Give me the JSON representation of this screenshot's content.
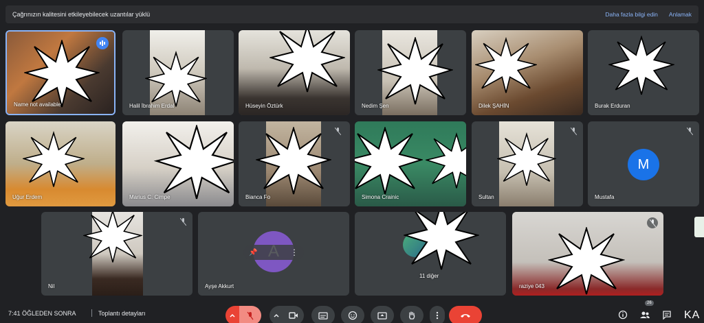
{
  "notice": {
    "message": "Çağrınızın kalitesini etkileyebilecek uzantılar yüklü",
    "learn_more": "Daha fazla bilgi edin",
    "dismiss": "Anlamak"
  },
  "participants": [
    {
      "name": "Name not available"
    },
    {
      "name": "Halil İbrahim Erdal"
    },
    {
      "name": "Hüseyin Öztürk"
    },
    {
      "name": "Nedim Şen"
    },
    {
      "name": "Dilek ŞAHİN"
    },
    {
      "name": "Burak Erduran"
    },
    {
      "name": "Uğur Erdem"
    },
    {
      "name": "Marius C. Cimpe"
    },
    {
      "name": "Bianca Fo"
    },
    {
      "name": "Simona Crainic"
    },
    {
      "name": "Sultan"
    },
    {
      "name": "Mustafa",
      "initial": "M"
    },
    {
      "name": "Nil"
    },
    {
      "name": "Ayşe Akkurt",
      "initial": "A"
    },
    {
      "name": "11 diğer"
    },
    {
      "name": "raziye 043"
    }
  ],
  "bottom": {
    "time": "7:41 ÖĞLEDEN SONRA",
    "details": "Toplantı detayları",
    "participant_count": "26"
  },
  "watermark": "KA",
  "colors": {
    "background": "#202124",
    "tile": "#3c4043",
    "accent_blue": "#8ab4f8",
    "end_call": "#ea4335",
    "avatar_m": "#1a73e8",
    "avatar_a": "#7e57c2"
  }
}
